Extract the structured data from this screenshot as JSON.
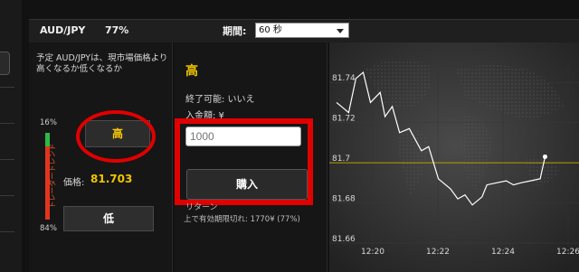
{
  "header": {
    "pair": "AUD/JPY",
    "percent": "77%",
    "period_label": "期間:",
    "period_value": "60 秒"
  },
  "left_panel": {
    "description": "予定 AUD/JPYは、現市場価格より高くなるか低くなるか",
    "trend_top_percent": "16%",
    "trend_bottom_percent": "84%",
    "trend_label": "トレーダートレンド",
    "trend_up_fraction": 0.16,
    "high_button": "高",
    "price_label": "価格:",
    "price_value": "81.703",
    "low_button": "低"
  },
  "middle_panel": {
    "title": "高",
    "expiry_text": "終了可能: いいえ",
    "amount_label": "入金額: ¥",
    "amount_placeholder": "1000",
    "buy_button": "購入",
    "return_label": "リターン",
    "payout_text": "上で有効期限切れ: 1770¥ (77%)"
  },
  "colors": {
    "accent_yellow": "#f0c400",
    "highlight_red": "#e00000",
    "trend_green": "#2eb84b",
    "trend_red": "#e2341d"
  },
  "chart_data": {
    "type": "line",
    "y_ticks": [
      "81.74",
      "81.72",
      "81.7",
      "81.68",
      "81.66"
    ],
    "x_ticks": [
      "12:20",
      "12:22",
      "12:24",
      "12:26"
    ],
    "ylim": [
      81.66,
      81.75
    ],
    "current_price_line": 81.7,
    "series": [
      {
        "x": [
          0,
          0.05,
          0.08,
          0.11,
          0.14,
          0.18,
          0.2,
          0.23,
          0.26,
          0.3,
          0.35,
          0.38,
          0.42,
          0.47,
          0.5,
          0.53,
          0.56,
          0.6,
          0.62,
          0.66,
          0.7,
          0.73,
          0.76,
          0.8,
          0.84,
          0.86
        ],
        "values": [
          81.73,
          81.725,
          81.742,
          81.745,
          81.73,
          81.735,
          81.723,
          81.728,
          81.715,
          81.717,
          81.706,
          81.708,
          81.692,
          81.687,
          81.682,
          81.684,
          81.679,
          81.683,
          81.689,
          81.69,
          81.691,
          81.689,
          81.69,
          81.691,
          81.692,
          81.703
        ]
      }
    ]
  }
}
